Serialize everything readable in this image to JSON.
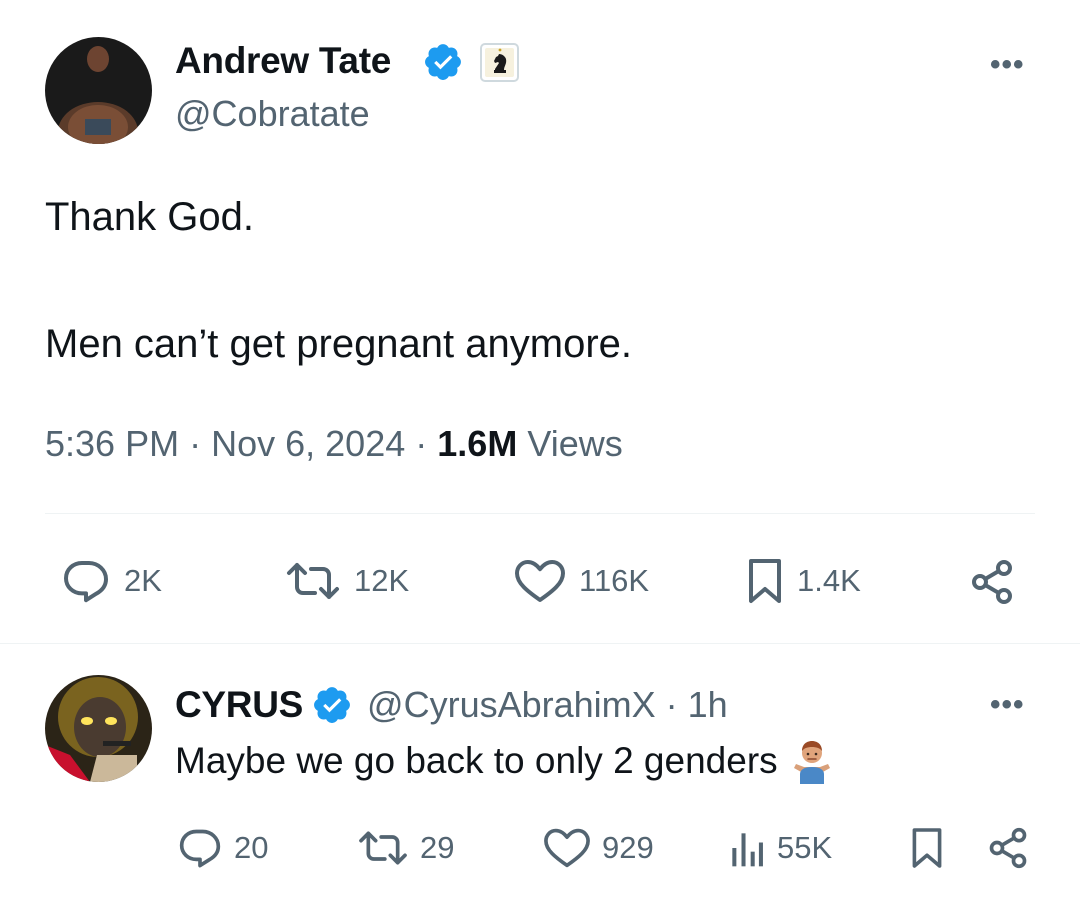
{
  "main_tweet": {
    "display_name": "Andrew Tate",
    "handle": "@Cobratate",
    "more": "•••",
    "text_line_1": "Thank God.",
    "text_line_2": "Men can’t get pregnant anymore.",
    "time": "5:36 PM",
    "date": "Nov 6, 2024",
    "views_count": "1.6M",
    "views_label": "Views",
    "separator": "·",
    "actions": {
      "replies": "2K",
      "reposts": "12K",
      "likes": "116K",
      "bookmarks": "1.4K"
    }
  },
  "reply": {
    "display_name": "CYRUS",
    "handle": "@CyrusAbrahimX",
    "separator": "·",
    "age": "1h",
    "more": "•••",
    "text": "Maybe we go back to only 2 genders",
    "emoji": "man-shrugging-emoji",
    "actions": {
      "replies": "20",
      "reposts": "29",
      "likes": "929",
      "views": "55K"
    }
  },
  "colors": {
    "text_primary": "#0f1419",
    "text_secondary": "#536471",
    "verified_blue": "#1d9bf0",
    "divider": "#eff3f4"
  }
}
